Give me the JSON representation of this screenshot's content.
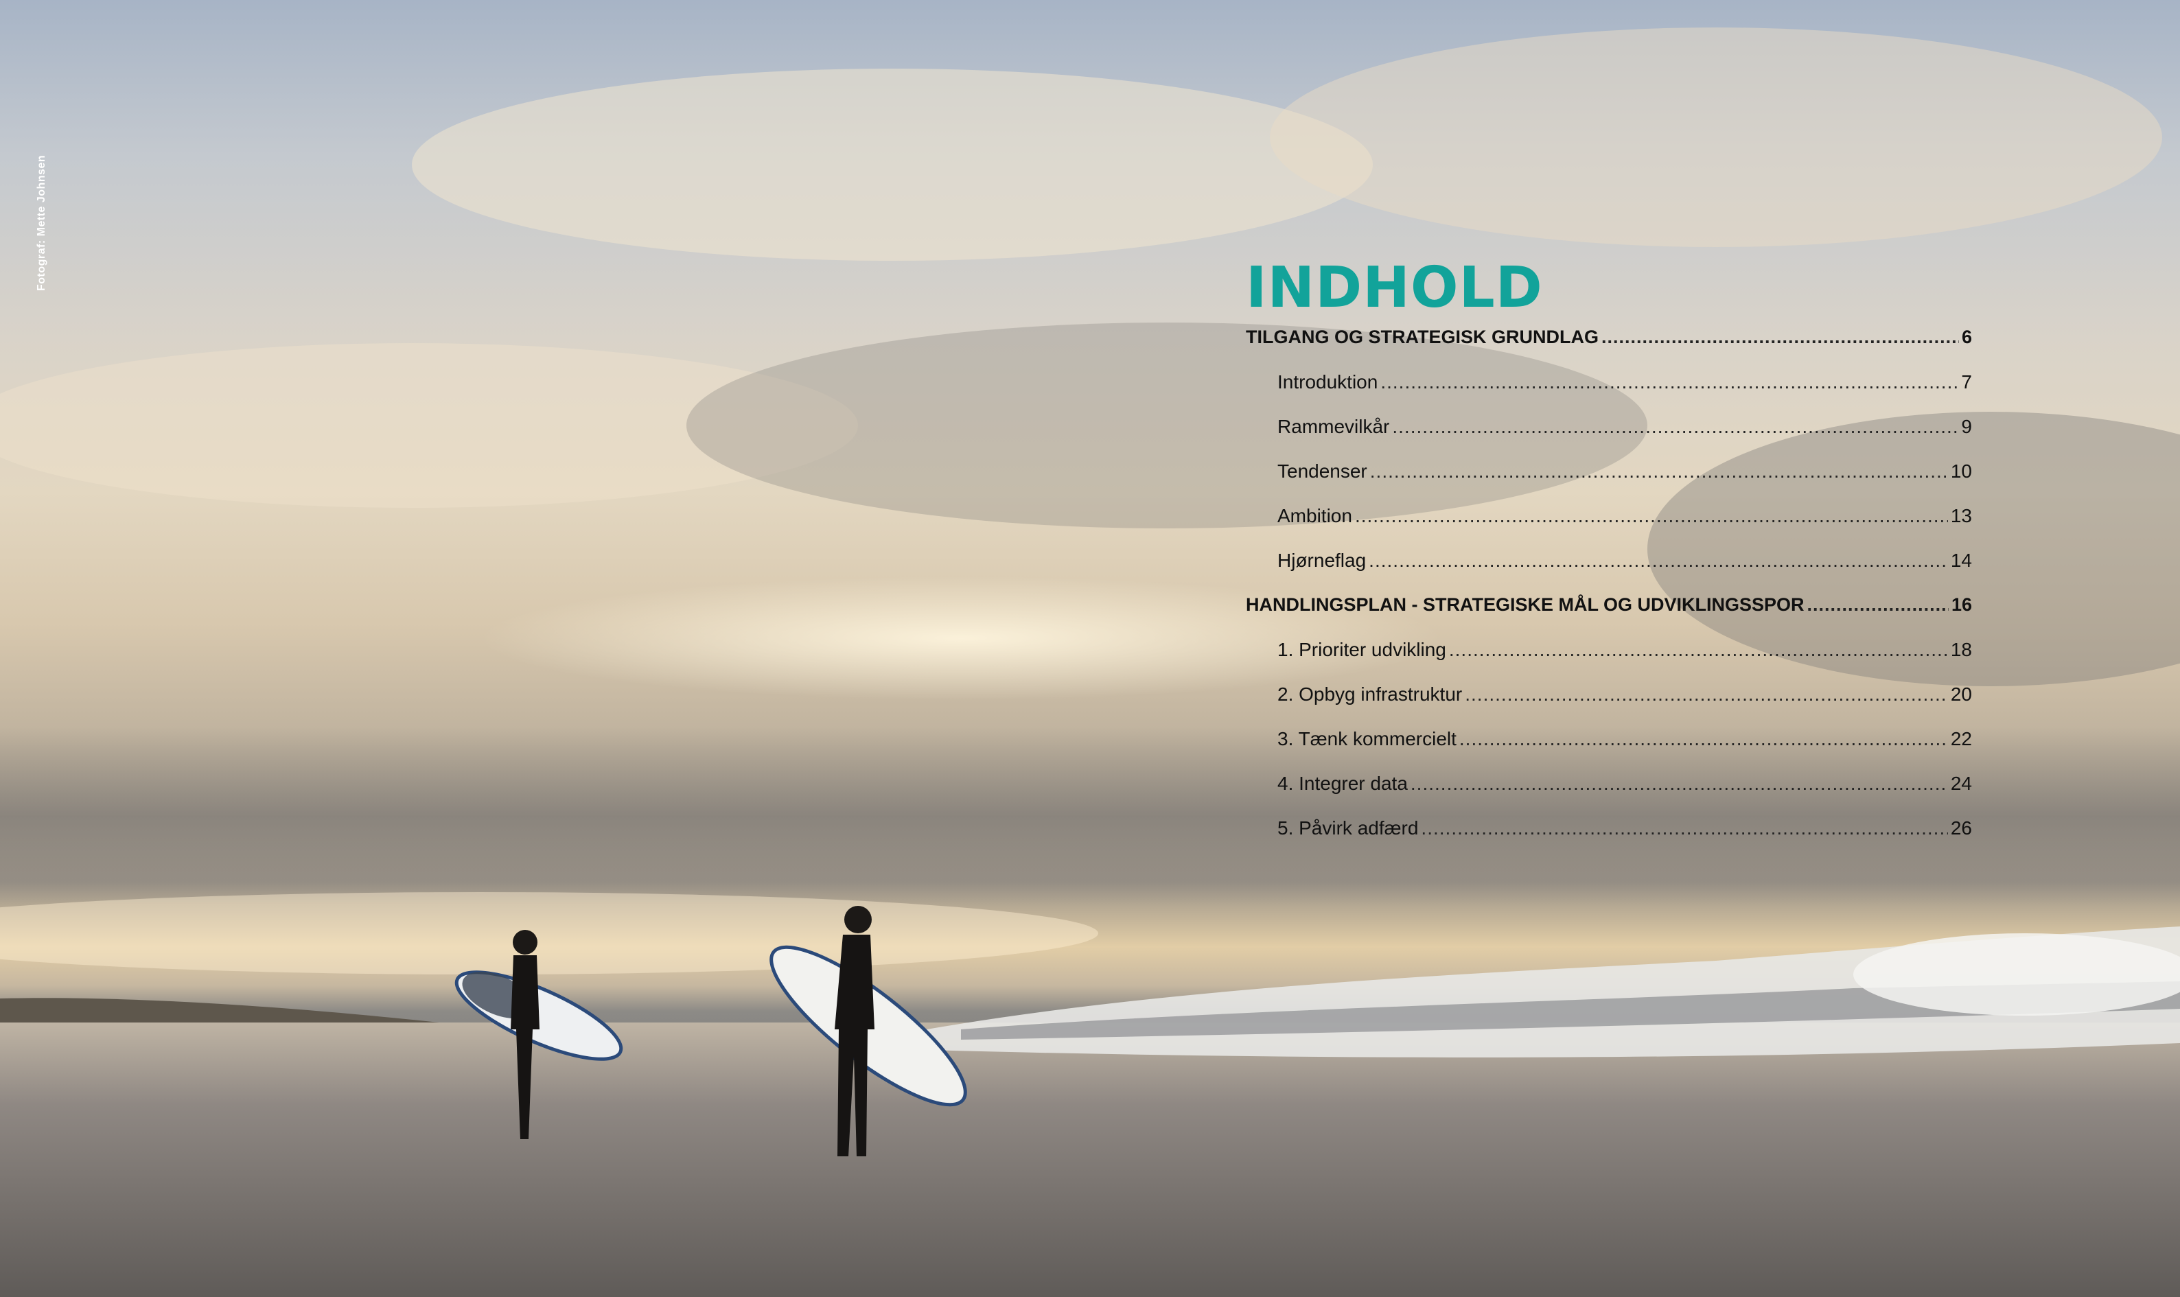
{
  "photo_credit": "Fotograf: Mette Johnsen",
  "toc": {
    "title": "INDHOLD",
    "entries": [
      {
        "label": "TILGANG OG STRATEGISK GRUNDLAG",
        "page": "6"
      },
      {
        "label": "Introduktion",
        "page": "7"
      },
      {
        "label": "Rammevilkår",
        "page": "9"
      },
      {
        "label": "Tendenser",
        "page": "10"
      },
      {
        "label": "Ambition",
        "page": "13"
      },
      {
        "label": "Hjørneflag",
        "page": "14"
      },
      {
        "label": "HANDLINGSPLAN - STRATEGISKE MÅL OG UDVIKLINGSSPOR",
        "page": "16"
      },
      {
        "label": "1. Prioriter udvikling",
        "page": "18"
      },
      {
        "label": "2. Opbyg infrastruktur",
        "page": "20"
      },
      {
        "label": "3. Tænk kommercielt",
        "page": "22"
      },
      {
        "label": "4. Integrer data",
        "page": "24"
      },
      {
        "label": "5. Påvirk adfærd",
        "page": "26"
      }
    ]
  },
  "colors": {
    "title_accent": "#12a39a",
    "text": "#111111"
  }
}
